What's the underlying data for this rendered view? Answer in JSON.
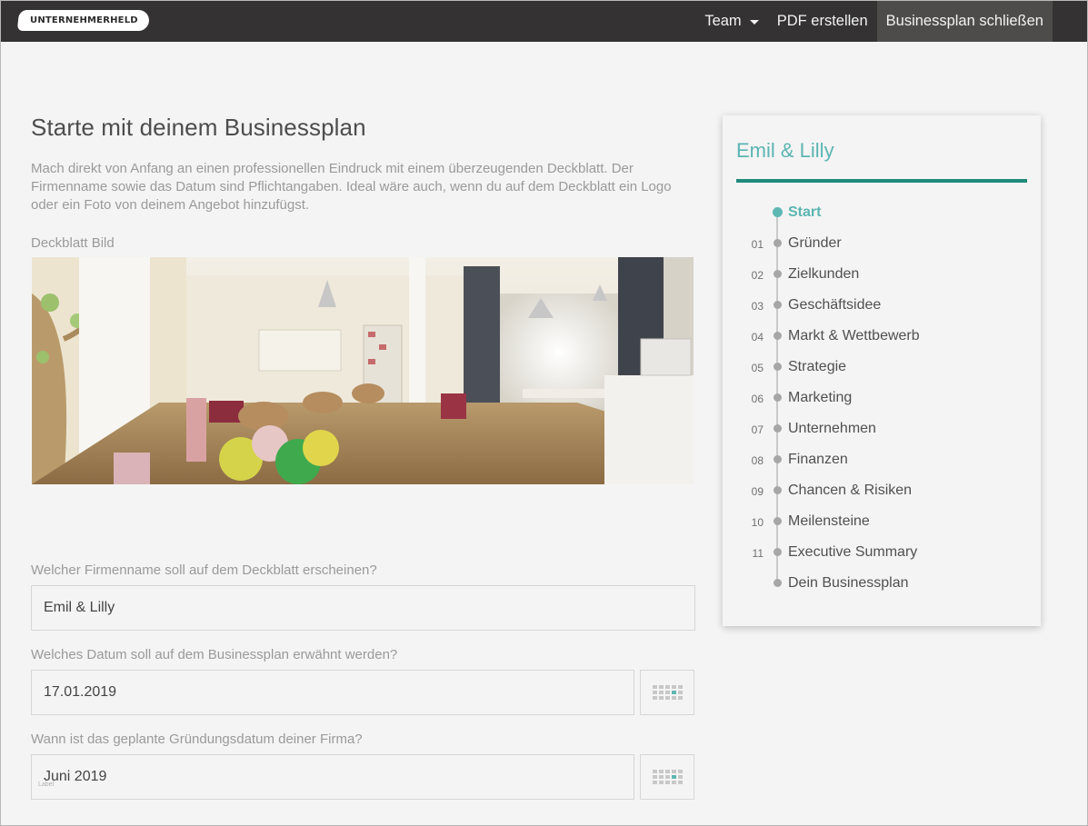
{
  "topbar": {
    "logo_text": "UNTERNEHMERHELD",
    "nav": [
      {
        "label": "Team",
        "has_dropdown": true
      },
      {
        "label": "PDF erstellen"
      },
      {
        "label": "Businessplan schließen",
        "active": true
      }
    ]
  },
  "main": {
    "title": "Starte mit deinem Businessplan",
    "intro": "Mach direkt von Anfang an einen professionellen Eindruck mit einem überzeugenden Deckblatt. Der Firmenname sowie das Datum sind Pflichtangaben. Ideal wäre auch, wenn du auf dem Deckblatt ein Logo oder ein Foto von deinem Angebot hinzufügst.",
    "cover_label": "Deckblatt Bild",
    "company": {
      "question": "Welcher Firmenname soll auf dem Deckblatt erscheinen?",
      "value": "Emil & Lilly"
    },
    "plan_date": {
      "question": "Welches Datum soll auf dem Businessplan erwähnt werden?",
      "value": "17.01.2019"
    },
    "founding_date": {
      "question": "Wann ist das geplante Gründungsdatum deiner Firma?",
      "value": "Juni 2019",
      "tiny_label": "Label"
    }
  },
  "sidebar": {
    "title": "Emil & Lilly",
    "accent": "#1f8a7a",
    "steps": [
      {
        "num": "",
        "label": "Start",
        "active": true
      },
      {
        "num": "01",
        "label": "Gründer"
      },
      {
        "num": "02",
        "label": "Zielkunden"
      },
      {
        "num": "03",
        "label": "Geschäftsidee"
      },
      {
        "num": "04",
        "label": "Markt & Wettbewerb"
      },
      {
        "num": "05",
        "label": "Strategie"
      },
      {
        "num": "06",
        "label": "Marketing"
      },
      {
        "num": "07",
        "label": "Unternehmen"
      },
      {
        "num": "08",
        "label": "Finanzen"
      },
      {
        "num": "09",
        "label": "Chancen & Risiken"
      },
      {
        "num": "10",
        "label": "Meilensteine"
      },
      {
        "num": "11",
        "label": "Executive Summary"
      },
      {
        "num": "",
        "label": "Dein Businessplan"
      }
    ]
  }
}
